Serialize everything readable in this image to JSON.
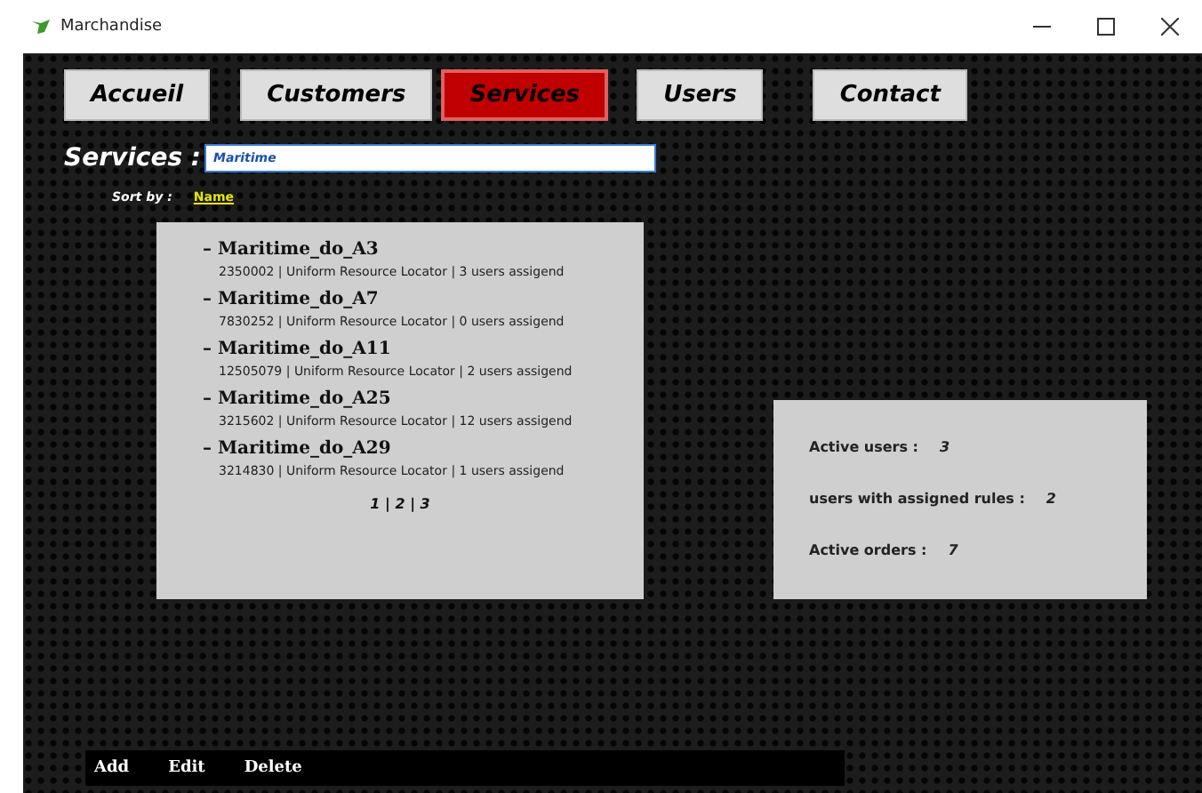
{
  "window": {
    "title": "Marchandise"
  },
  "nav": [
    {
      "label": "Accueil",
      "selected": false
    },
    {
      "label": "Customers",
      "selected": false
    },
    {
      "label": "Services",
      "selected": true
    },
    {
      "label": "Users",
      "selected": false
    },
    {
      "label": "Contact",
      "selected": false
    }
  ],
  "search": {
    "label": "Services :",
    "value": "Maritime"
  },
  "sort": {
    "label": "Sort by :",
    "value": "Name"
  },
  "services": [
    {
      "name": "– Maritime_do_A3",
      "details": "2350002 | Uniform Resource Locator | 3 users assigend"
    },
    {
      "name": "– Maritime_do_A7",
      "details": "7830252 | Uniform Resource Locator | 0 users assigend"
    },
    {
      "name": "– Maritime_do_A11",
      "details": "12505079 | Uniform Resource Locator | 2 users assigend"
    },
    {
      "name": "– Maritime_do_A25",
      "details": "3215602 | Uniform Resource Locator | 12 users assigend"
    },
    {
      "name": "– Maritime_do_A29",
      "details": "3214830 | Uniform Resource Locator | 1 users assigend"
    }
  ],
  "pagination": "1 | 2 | 3",
  "stats": [
    {
      "label": "Active users :",
      "value": "3"
    },
    {
      "label": "users with assigned rules :",
      "value": "2"
    },
    {
      "label": "Active orders :",
      "value": "7"
    }
  ],
  "actions": [
    "Add",
    "Edit",
    "Delete"
  ]
}
